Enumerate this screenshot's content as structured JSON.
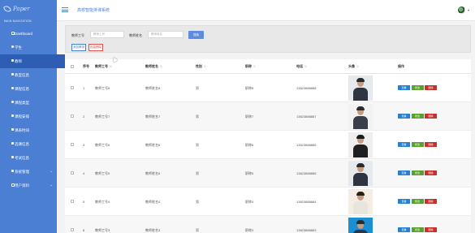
{
  "app": {
    "logo_text": "Paper",
    "title": "高校智能排课系统"
  },
  "sidebar": {
    "heading": "MAIN NAVIGATION",
    "items": [
      {
        "label": "Dashboard",
        "icon": "home-outline-icon"
      },
      {
        "label": "学生",
        "icon": "bullet-icon"
      },
      {
        "label": "教师",
        "icon": "grid-icon",
        "active": true
      },
      {
        "label": "教室信息",
        "icon": "grid-icon"
      },
      {
        "label": "课程信息",
        "icon": "bullet-icon"
      },
      {
        "label": "课程类型",
        "icon": "bullet-icon"
      },
      {
        "label": "课程安排",
        "icon": "grid-icon"
      },
      {
        "label": "课表时间",
        "icon": "grid-icon"
      },
      {
        "label": "选课信息",
        "icon": "grid-icon"
      },
      {
        "label": "考试信息",
        "icon": "grid-icon"
      },
      {
        "label": "系统管理",
        "icon": "grid-icon",
        "expandable": true
      },
      {
        "label": "用户资料",
        "icon": "user-card-icon",
        "expandable": true
      }
    ]
  },
  "search": {
    "field1_label": "教师工号",
    "field1_placeholder": "教师工号",
    "field2_label": "教师姓名",
    "field2_placeholder": "教师姓名",
    "search_button": "搜索",
    "add_button": "添加教师",
    "batch_delete_button": "批量删除"
  },
  "table": {
    "columns": [
      "序号",
      "教师工号",
      "教师姓名",
      "性别",
      "职称",
      "电话",
      "头像",
      "操作"
    ],
    "sortable": [
      false,
      true,
      true,
      true,
      true,
      true,
      true,
      false
    ],
    "rows": [
      {
        "index": "1",
        "id": "教师工号8",
        "name": "教师姓名8",
        "gender": "男",
        "title": "职称8",
        "phone": "13823888888",
        "photo": "male-suit"
      },
      {
        "index": "2",
        "id": "教师工号7",
        "name": "教师姓名7",
        "gender": "男",
        "title": "职称7",
        "phone": "13823888887",
        "photo": "male-sitting"
      },
      {
        "index": "3",
        "id": "教师工号6",
        "name": "教师姓名6",
        "gender": "男",
        "title": "职称6",
        "phone": "13823888886",
        "photo": "female-standing"
      },
      {
        "index": "4",
        "id": "教师工号5",
        "name": "教师姓名5",
        "gender": "男",
        "title": "职称5",
        "phone": "13823888885",
        "photo": "male-suit"
      },
      {
        "index": "5",
        "id": "教师工号4",
        "name": "教师姓名4",
        "gender": "男",
        "title": "职称4",
        "phone": "13823888884",
        "photo": "female-longhair"
      },
      {
        "index": "6",
        "id": "教师工号3",
        "name": "教师姓名3",
        "gender": "男",
        "title": "职称3",
        "phone": "13823888883",
        "photo": "male-glasses"
      }
    ],
    "op_view": "查看",
    "op_edit": "修改",
    "op_delete": "删除"
  },
  "colors": {
    "sidebar": "#4a7fd4",
    "sidebar_active": "#2d5eb4",
    "view": "#2a7fd1",
    "edit": "#5aa02c",
    "delete": "#c9302c"
  }
}
